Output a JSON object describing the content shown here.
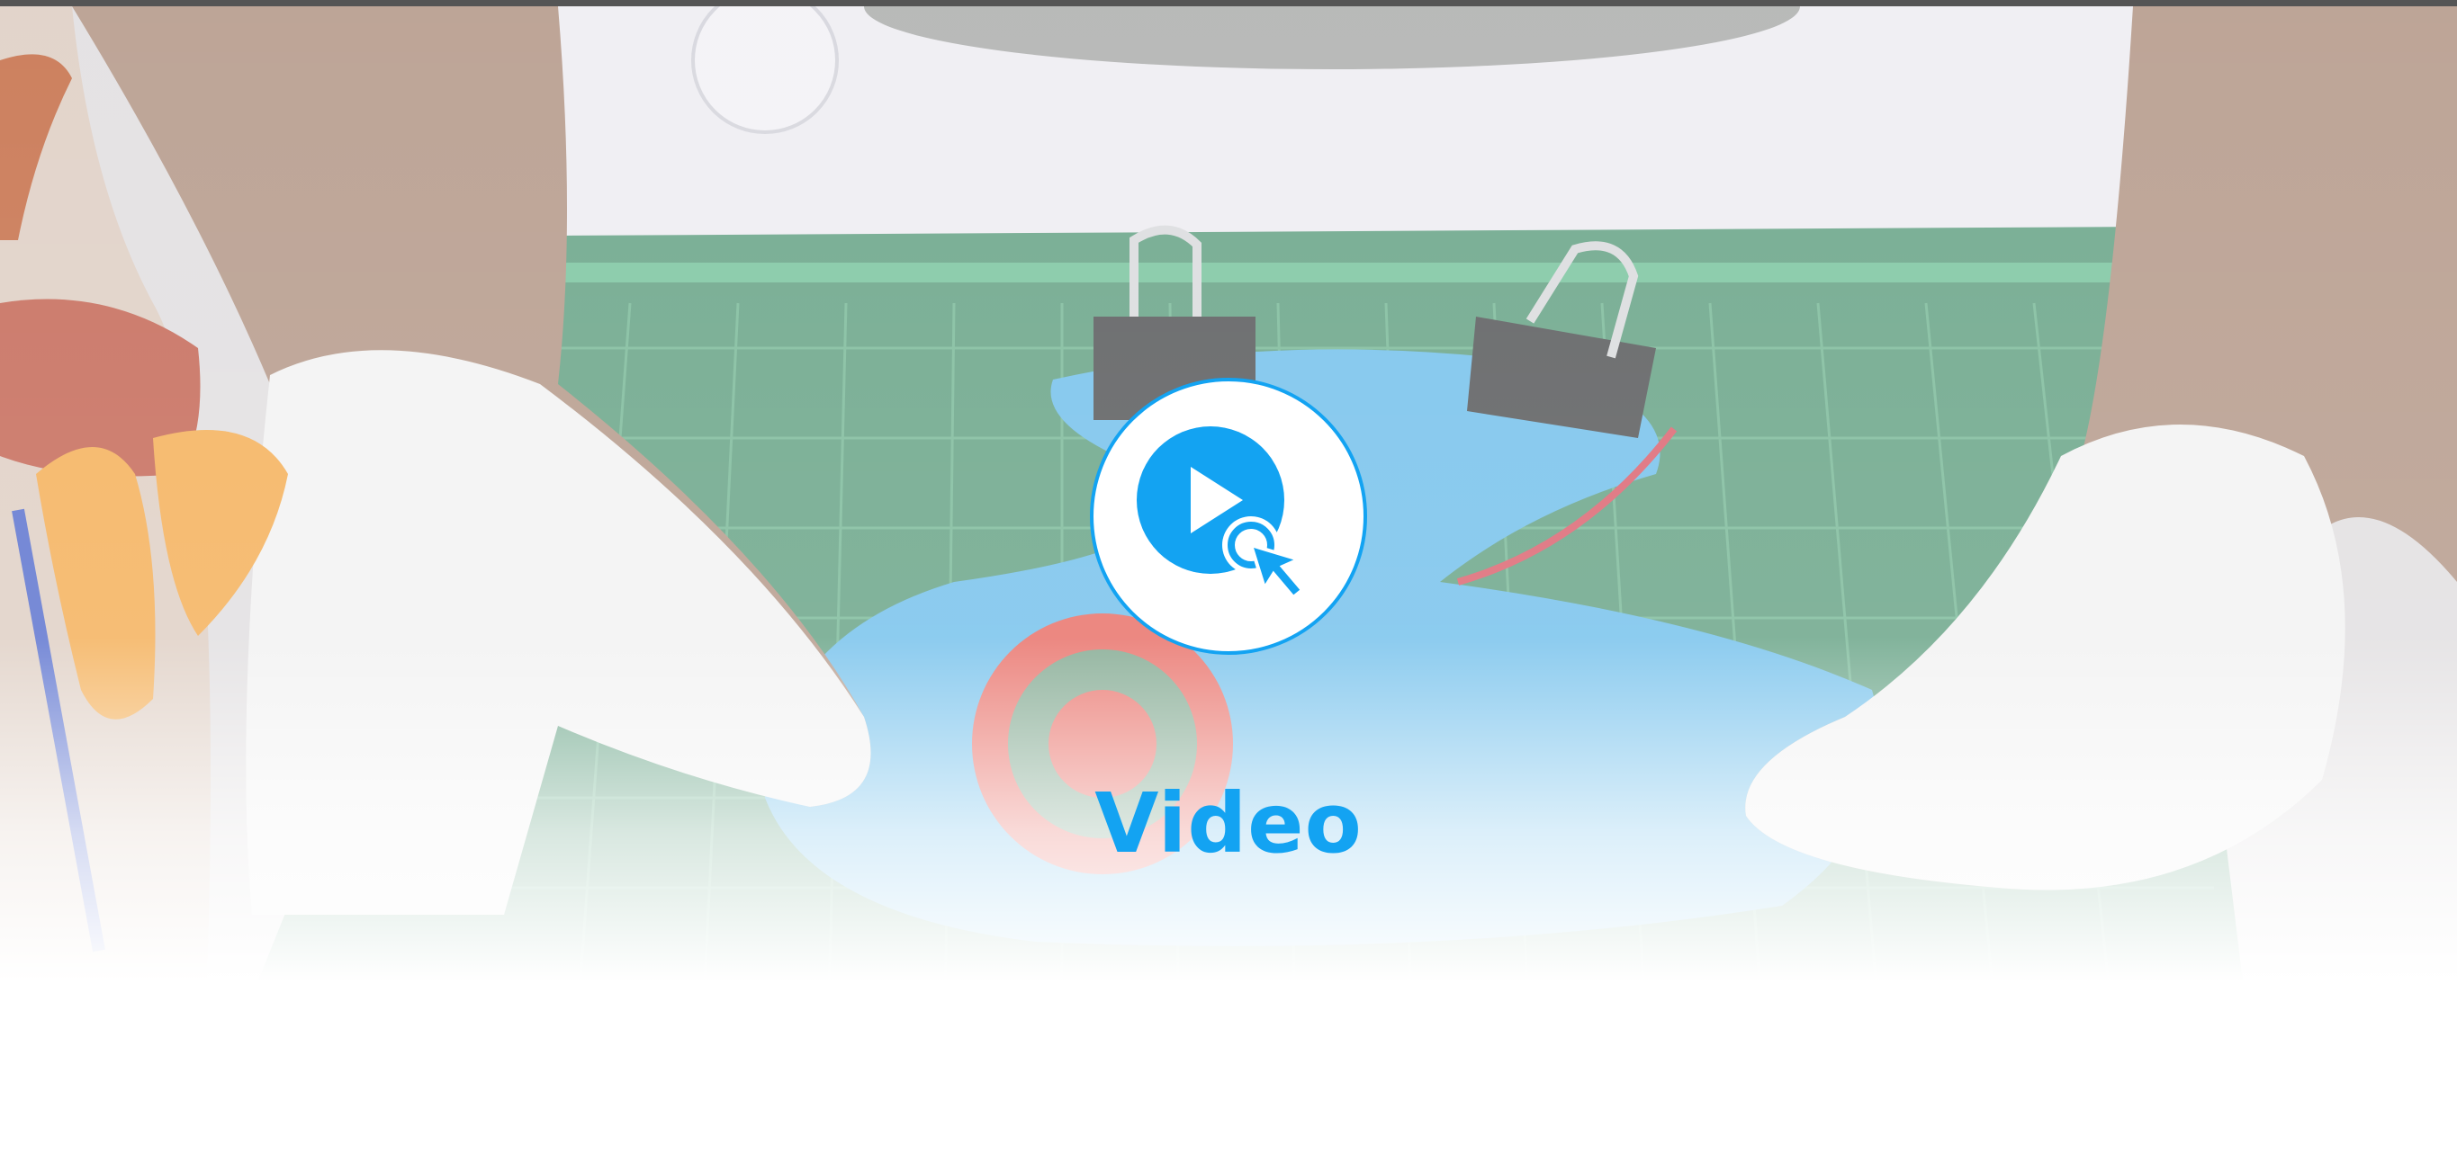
{
  "hero": {
    "label": "Video",
    "icon": "video-play-cursor-icon",
    "accent_color": "#13a3f2"
  }
}
